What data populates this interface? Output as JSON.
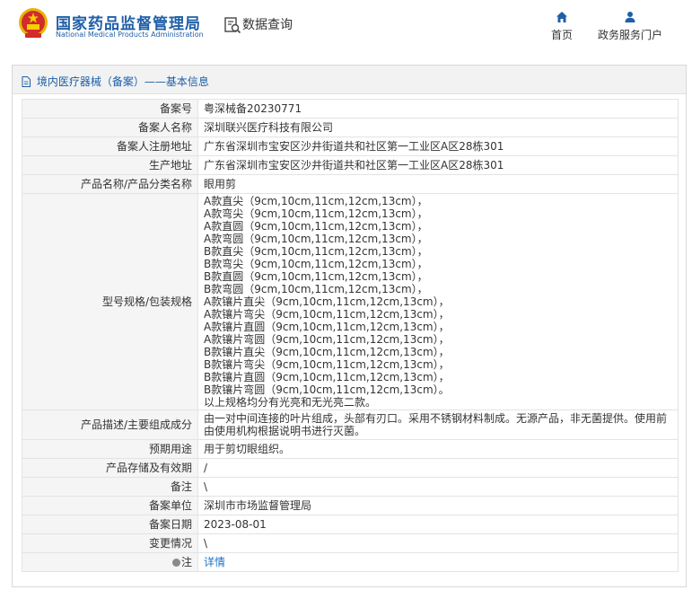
{
  "header": {
    "logo_cn": "国家药品监督管理局",
    "logo_en": "National Medical Products Administration",
    "query_label": "数据查询",
    "nav": [
      {
        "label": "首页",
        "icon": "home-icon"
      },
      {
        "label": "政务服务门户",
        "icon": "user-icon"
      }
    ]
  },
  "colors": {
    "brand": "#1f5fa8",
    "link": "#1a73c8",
    "key_bg": "#f5f5f5",
    "emblem_red": "#d22b2b",
    "emblem_gold": "#e8b400"
  },
  "panel": {
    "title": "境内医疗器械（备案）——基本信息"
  },
  "record": {
    "rows": [
      {
        "key": "备案号",
        "value": "粤深械备20230771"
      },
      {
        "key": "备案人名称",
        "value": "深圳联兴医疗科技有限公司"
      },
      {
        "key": "备案人注册地址",
        "value": "广东省深圳市宝安区沙井街道共和社区第一工业区A区28栋301"
      },
      {
        "key": "生产地址",
        "value": "广东省深圳市宝安区沙井街道共和社区第一工业区A区28栋301"
      },
      {
        "key": "产品名称/产品分类名称",
        "value": "眼用剪"
      }
    ],
    "spec_key": "型号规格/包装规格",
    "spec_lines": [
      "A款直尖（9cm,10cm,11cm,12cm,13cm），",
      "A款弯尖（9cm,10cm,11cm,12cm,13cm），",
      "A款直圆（9cm,10cm,11cm,12cm,13cm），",
      "A款弯圆（9cm,10cm,11cm,12cm,13cm），",
      "B款直尖（9cm,10cm,11cm,12cm,13cm），",
      "B款弯尖（9cm,10cm,11cm,12cm,13cm），",
      "B款直圆（9cm,10cm,11cm,12cm,13cm），",
      "B款弯圆（9cm,10cm,11cm,12cm,13cm），",
      "A款镶片直尖（9cm,10cm,11cm,12cm,13cm），",
      "A款镶片弯尖（9cm,10cm,11cm,12cm,13cm），",
      "A款镶片直圆（9cm,10cm,11cm,12cm,13cm），",
      "A款镶片弯圆（9cm,10cm,11cm,12cm,13cm），",
      "B款镶片直尖（9cm,10cm,11cm,12cm,13cm），",
      "B款镶片弯尖（9cm,10cm,11cm,12cm,13cm），",
      "B款镶片直圆（9cm,10cm,11cm,12cm,13cm），",
      "B款镶片弯圆（9cm,10cm,11cm,12cm,13cm）。",
      "以上规格均分有光亮和无光亮二款。"
    ],
    "desc_key": "产品描述/主要组成成分",
    "desc_value": "由一对中间连接的叶片组成，头部有刃口。采用不锈钢材料制成。无源产品，非无菌提供。使用前由使用机构根据说明书进行灭菌。",
    "rows2": [
      {
        "key": "预期用途",
        "value": "用于剪切眼组织。"
      },
      {
        "key": "产品存储及有效期",
        "value": "/"
      },
      {
        "key": "备注",
        "value": "\\"
      },
      {
        "key": "备案单位",
        "value": "深圳市市场监督管理局"
      },
      {
        "key": "备案日期",
        "value": "2023-08-01"
      },
      {
        "key": "变更情况",
        "value": "\\"
      }
    ],
    "note_key": "注",
    "note_link": "详情"
  }
}
